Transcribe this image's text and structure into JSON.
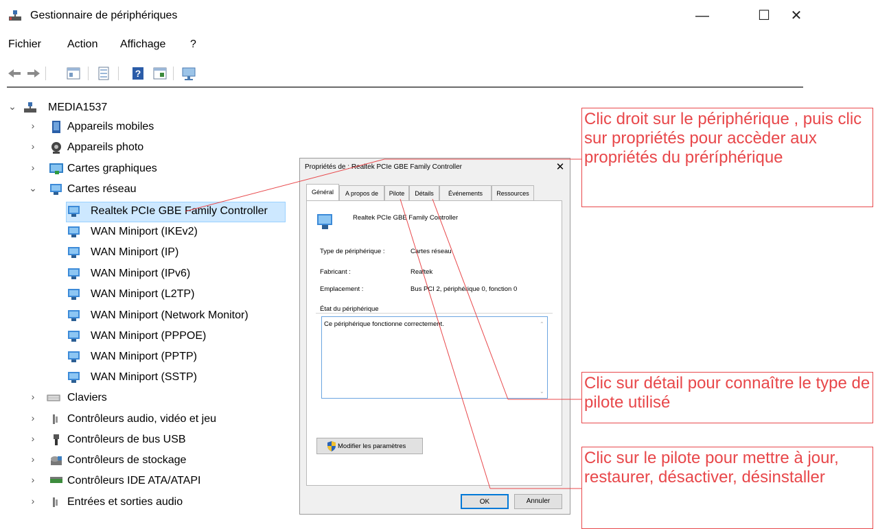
{
  "window": {
    "title": "Gestionnaire de périphériques",
    "controls": {
      "minimize": "—",
      "maximize": "☐",
      "close": "✕"
    }
  },
  "menu": [
    "Fichier",
    "Action",
    "Affichage",
    "?"
  ],
  "toolbar": [
    "back-icon",
    "forward-icon",
    "properties-icon",
    "view-icon",
    "help-icon",
    "details-icon",
    "scan-icon"
  ],
  "tree": {
    "root": "MEDIA1537",
    "items": [
      "Appareils mobiles",
      "Appareils photo",
      "Cartes graphiques",
      "Cartes réseau",
      "Realtek PCIe GBE Family Controller",
      "WAN Miniport (IKEv2)",
      "WAN Miniport (IP)",
      "WAN Miniport (IPv6)",
      "WAN Miniport (L2TP)",
      "WAN Miniport (Network Monitor)",
      "WAN Miniport (PPPOE)",
      "WAN Miniport (PPTP)",
      "WAN Miniport (SSTP)",
      "Claviers",
      "Contrôleurs audio, vidéo et jeu",
      "Contrôleurs de bus USB",
      "Contrôleurs de stockage",
      "Contrôleurs IDE ATA/ATAPI",
      "Entrées et sorties audio"
    ]
  },
  "dialog": {
    "title": "Propriétés de : Realtek PCIe GBE Family Controller",
    "close": "✕",
    "tabs": [
      "Général",
      "A propos de",
      "Pilote",
      "Détails",
      "Événements",
      "Ressources"
    ],
    "device_name": "Realtek PCIe GBE Family Controller",
    "type_label": "Type de périphérique :",
    "type_value": "Cartes réseau",
    "manufacturer_label": "Fabricant :",
    "manufacturer_value": "Realtek",
    "location_label": "Emplacement :",
    "location_value": "Bus PCI 2, périphérique 0, fonction 0",
    "status_group": "État du périphérique",
    "status_text": "Ce périphérique fonctionne correctement.",
    "modify_button": "Modifier les paramètres",
    "ok_button": "OK",
    "cancel_button": "Annuler"
  },
  "annotations": {
    "note1": "Clic droit sur le périphérique , puis clic sur propriétés pour accèder aux propriétés du préríphérique",
    "note2": "Clic sur détail pour connaître le type de pilote utilisé",
    "note3": "Clic sur le pilote pour mettre à jour, restaurer, désactiver, désinstaller"
  },
  "colors": {
    "annotation": "#e8474a",
    "selection": "#cde8ff",
    "accent": "#0078d7"
  }
}
